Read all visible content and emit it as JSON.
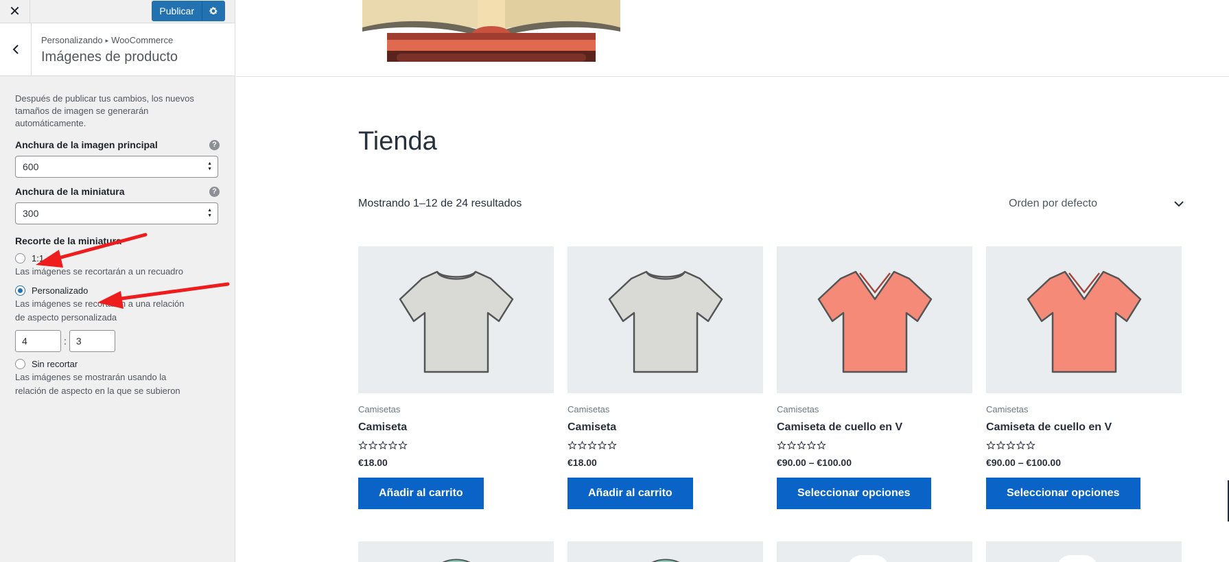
{
  "topbar": {
    "close_icon": "close-icon",
    "publish_label": "Publicar",
    "settings_icon": "gear-icon"
  },
  "section": {
    "breadcrumb_root": "Personalizando",
    "breadcrumb_sep": "▸",
    "breadcrumb_parent": "WooCommerce",
    "title": "Imágenes de producto"
  },
  "panel": {
    "description": "Después de publicar tus cambios, los nuevos tamaños de imagen se generarán automáticamente.",
    "main_width_label": "Anchura de la imagen principal",
    "main_width_value": "600",
    "thumb_width_label": "Anchura de la miniatura",
    "thumb_width_value": "300",
    "crop_label": "Recorte de la miniatura",
    "crop_options": [
      {
        "label": "1:1",
        "desc": "Las imágenes se recortarán a un recuadro",
        "checked": false
      },
      {
        "label": "Personalizado",
        "desc": "Las imágenes se recortarán a una relación de aspecto personalizada",
        "checked": true
      },
      {
        "label": "Sin recortar",
        "desc": "Las imágenes se mostrarán usando la relación de aspecto en la que se subieron",
        "checked": false
      }
    ],
    "ratio_width": "4",
    "ratio_sep": ":",
    "ratio_height": "3",
    "help_glyph": "?"
  },
  "preview": {
    "shop_title": "Tienda",
    "result_count": "Mostrando 1–12 de 24 resultados",
    "ordering": "Orden por defecto",
    "products": [
      {
        "category": "Camisetas",
        "name": "Camiseta",
        "price": "€18.00",
        "button": "Añadir al carrito",
        "color": "#d9d9d6"
      },
      {
        "category": "Camisetas",
        "name": "Camiseta",
        "price": "€18.00",
        "button": "Añadir al carrito",
        "color": "#d9d9d6"
      },
      {
        "category": "Camisetas",
        "name": "Camiseta de cuello en V",
        "price": "€90.00 – €100.00",
        "button": "Seleccionar opciones",
        "color": "#f58a78"
      },
      {
        "category": "Camisetas",
        "name": "Camiseta de cuello en V",
        "price": "€90.00 – €100.00",
        "button": "Seleccionar opciones",
        "color": "#f58a78"
      }
    ]
  },
  "colors": {
    "accent": "#2271b1",
    "button": "#0a63c7",
    "annotation_arrow": "#ee1c1c"
  }
}
